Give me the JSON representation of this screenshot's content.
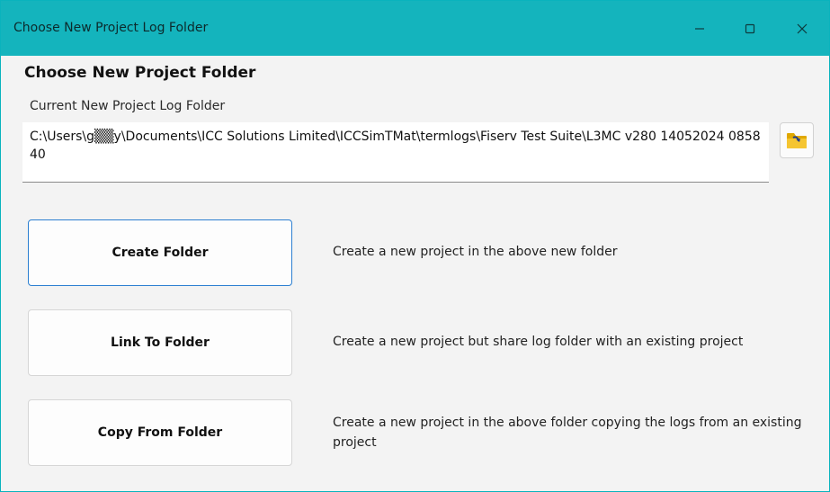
{
  "window": {
    "title": "Choose New Project Log Folder",
    "accent_color": "#14b4bd",
    "controls": {
      "minimize": "minimize-icon",
      "maximize": "maximize-icon",
      "close": "close-icon"
    }
  },
  "dialog": {
    "heading": "Choose New Project Folder",
    "current_label": "Current New Project Log Folder",
    "current_path": "C:\\Users\\g▒▒y\\Documents\\ICC Solutions Limited\\ICCSimTMat\\termlogs\\Fiserv Test Suite\\L3MC v280 14052024 085840",
    "browse_icon": "folder-open-icon"
  },
  "actions": [
    {
      "label": "Create Folder",
      "description": "Create a new project in the above new folder"
    },
    {
      "label": "Link To Folder",
      "description": "Create a new project but share log folder with an existing project"
    },
    {
      "label": "Copy From Folder",
      "description": "Create a new project in the above folder copying the logs from an existing project"
    }
  ]
}
